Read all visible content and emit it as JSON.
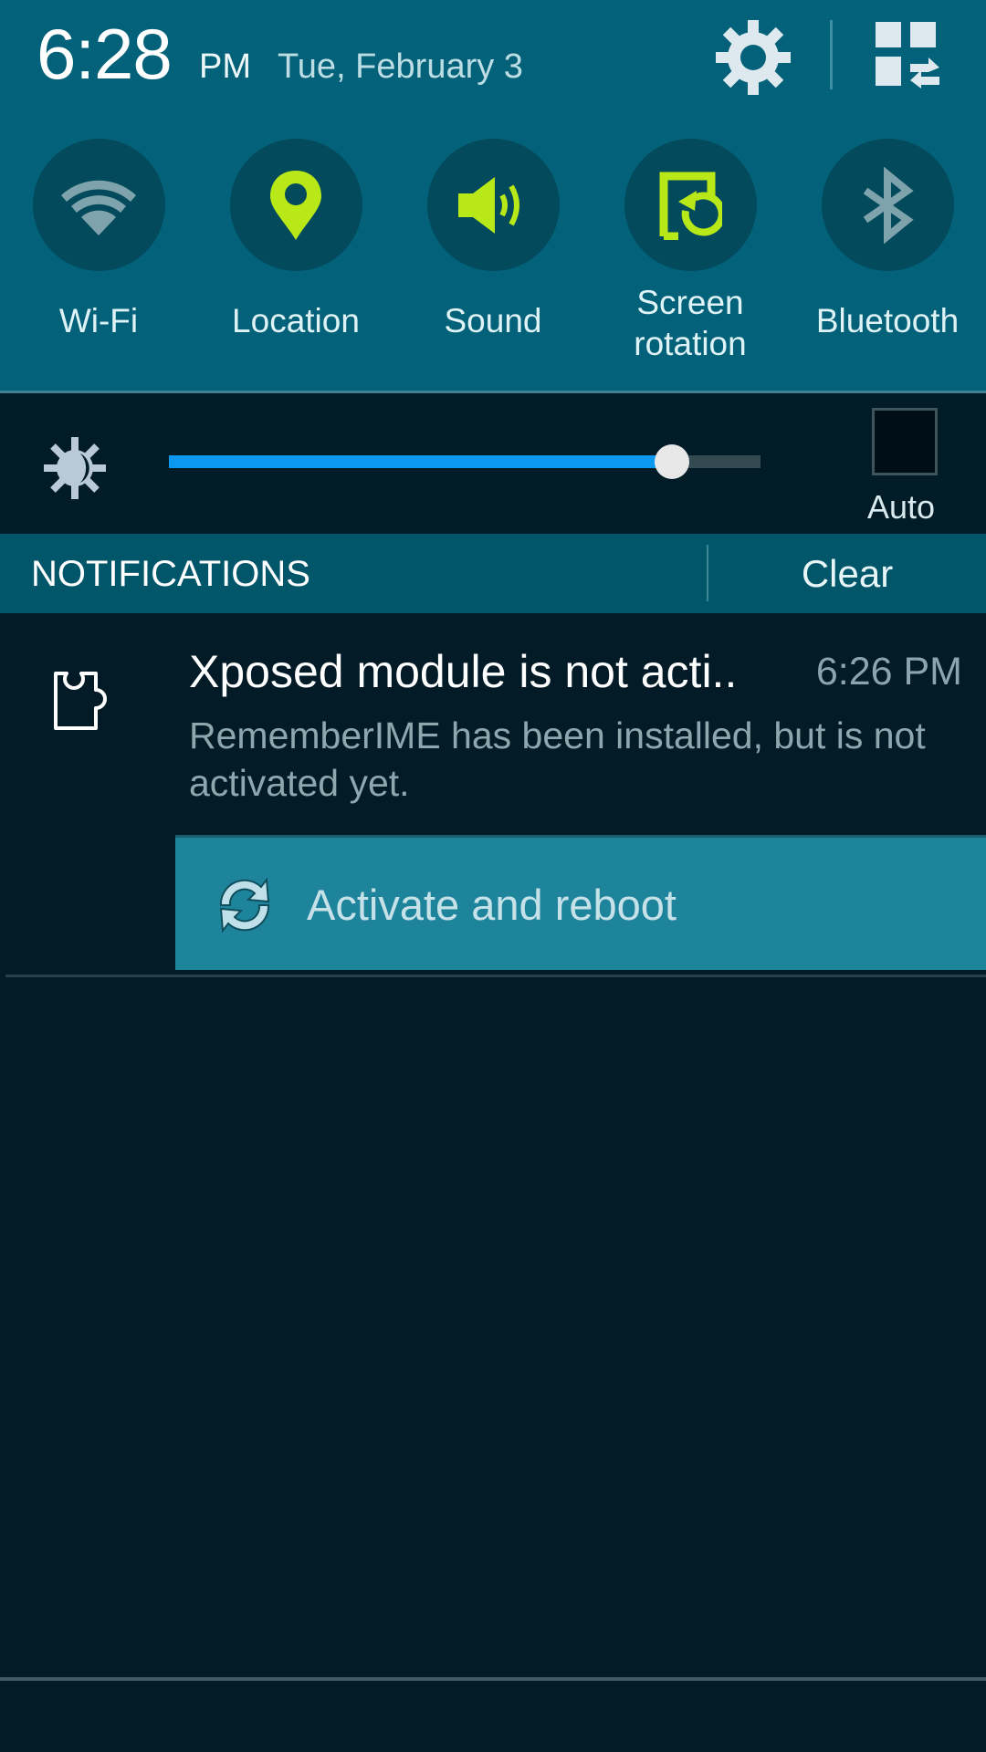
{
  "header": {
    "time": "6:28",
    "ampm": "PM",
    "date": "Tue, February 3",
    "settings_icon": "gear-icon",
    "edit_icon": "grid-edit-icon"
  },
  "quick_toggles": [
    {
      "label": "Wi-Fi",
      "icon": "wifi-icon",
      "active": false
    },
    {
      "label": "Location",
      "icon": "location-pin-icon",
      "active": true
    },
    {
      "label": "Sound",
      "icon": "speaker-icon",
      "active": true
    },
    {
      "label": "Screen\nrotation",
      "label_line1": "Screen",
      "label_line2": "rotation",
      "icon": "screen-rotation-icon",
      "active": true
    },
    {
      "label": "Bluetooth",
      "icon": "bluetooth-icon",
      "active": false
    }
  ],
  "brightness": {
    "value_percent": 85,
    "auto_label": "Auto",
    "auto_checked": false
  },
  "notifications": {
    "header": "NOTIFICATIONS",
    "clear_label": "Clear",
    "items": [
      {
        "icon": "puzzle-piece-icon",
        "title": "Xposed module is not acti..",
        "time": "6:26 PM",
        "body": "RememberIME has been installed, but is not activated yet.",
        "action": {
          "icon": "refresh-icon",
          "label": "Activate and reboot"
        }
      }
    ]
  },
  "colors": {
    "header_bg": "#03627a",
    "active_icon": "#b8e817",
    "inactive_icon": "#7fa3ac",
    "slider_fill": "#0a98f0",
    "action_bg": "#1e849c"
  }
}
